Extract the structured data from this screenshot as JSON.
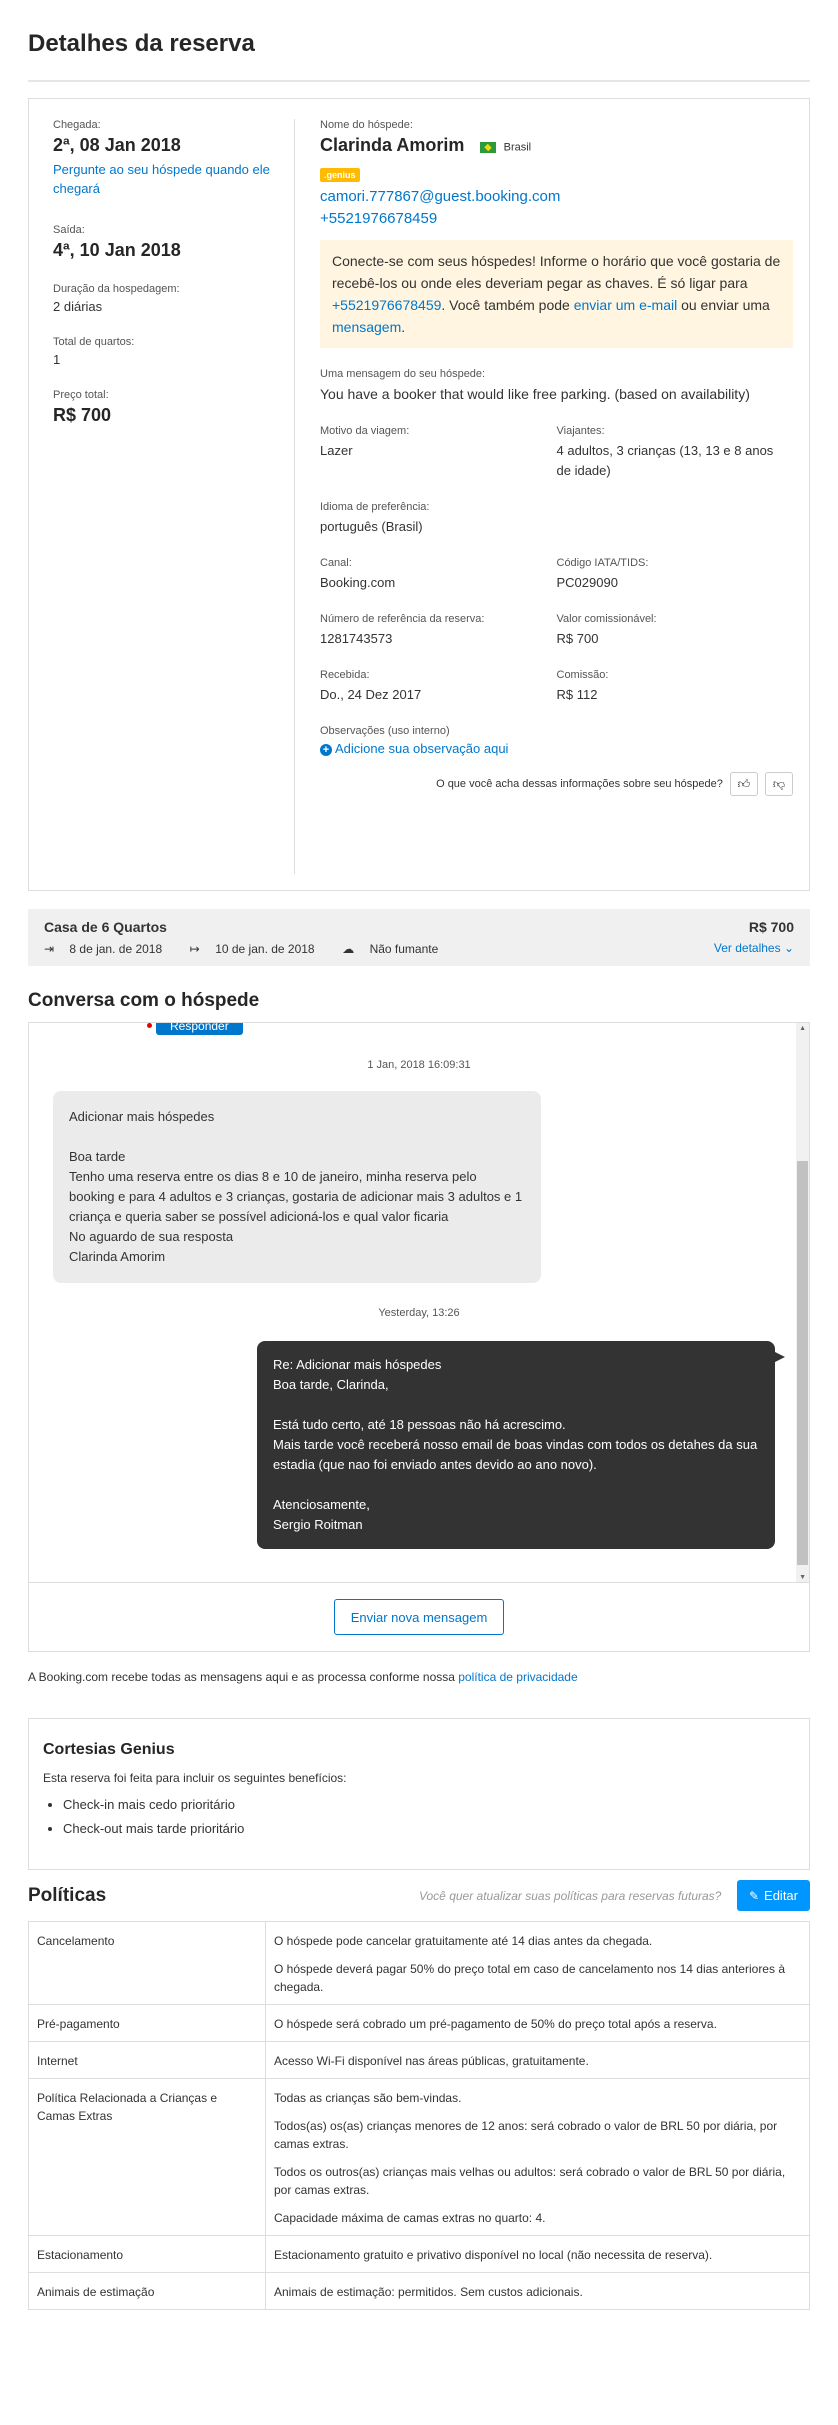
{
  "page": {
    "title": "Detalhes da reserva"
  },
  "booking": {
    "checkin_label": "Chegada:",
    "checkin_date": "2ª, 08 Jan 2018",
    "ask_guest_link": "Pergunte ao seu hóspede quando ele chegará",
    "checkout_label": "Saída:",
    "checkout_date": "4ª, 10 Jan 2018",
    "duration_label": "Duração da hospedagem:",
    "duration_value": "2 diárias",
    "rooms_label": "Total de quartos:",
    "rooms_value": "1",
    "price_label": "Preço total:",
    "price_value": "R$ 700"
  },
  "guest": {
    "name_label": "Nome do hóspede:",
    "name": "Clarinda Amorim",
    "country": "Brasil",
    "badge": ".genius",
    "email": "camori.777867@guest.booking.com",
    "phone": "+5521976678459",
    "notice": {
      "part1": "Conecte-se com seus hóspedes! Informe o horário que você gostaria de recebê-los ou onde eles deveriam pegar as chaves. É só ligar para ",
      "phone": "+5521976678459",
      "part2": ". Você também pode ",
      "email_link": "enviar um e-mail",
      "part3": " ou enviar uma ",
      "msg_link": "mensagem",
      "part4": "."
    },
    "message_label": "Uma mensagem do seu hóspede:",
    "message": "You have a booker that would like free parking. (based on availability)",
    "details": [
      {
        "label": "Motivo da viagem:",
        "value": "Lazer"
      },
      {
        "label": "Viajantes:",
        "value": "4 adultos, 3 crianças (13, 13 e 8 anos de idade)"
      },
      {
        "label": "Idioma de preferência:",
        "value": "português (Brasil)"
      },
      {
        "label": "",
        "value": ""
      },
      {
        "label": "Canal:",
        "value": "Booking.com"
      },
      {
        "label": "Código IATA/TIDS:",
        "value": "PC029090"
      },
      {
        "label": "Número de referência da reserva:",
        "value": "1281743573"
      },
      {
        "label": "Valor comissionável:",
        "value": "R$ 700"
      },
      {
        "label": "Recebida:",
        "value": "Do., 24 Dez 2017"
      },
      {
        "label": "Comissão:",
        "value": "R$ 112"
      }
    ],
    "notes_label": "Observações (uso interno)",
    "notes_add": "Adicione sua observação aqui",
    "feedback_q": "O que você acha dessas informações sobre seu hóspede?"
  },
  "room": {
    "title": "Casa de 6 Quartos",
    "checkin": "8 de jan. de 2018",
    "checkout": "10 de jan. de 2018",
    "smoking": "Não fumante",
    "price": "R$ 700",
    "more": "Ver detalhes"
  },
  "conversation": {
    "title": "Conversa com o hóspede",
    "reply": "Responder",
    "stamp1": "1 Jan, 2018 16:09:31",
    "incoming": [
      "Adicionar mais hóspedes",
      "",
      "Boa tarde",
      "Tenho uma reserva entre os dias 8 e 10 de janeiro, minha reserva pelo booking e para 4 adultos e 3 crianças, gostaria de adicionar mais 3 adultos e 1 criança e queria saber se possível adicioná-los e qual valor ficaria",
      "No aguardo de sua resposta",
      "Clarinda Amorim"
    ],
    "stamp2": "Yesterday, 13:26",
    "outgoing": [
      "Re: Adicionar mais hóspedes",
      "Boa tarde, Clarinda,",
      "",
      "Está tudo certo, até 18 pessoas não há acrescimo.",
      "Mais tarde você receberá nosso email de boas vindas com todos os detahes da sua estadia (que nao foi enviado antes devido ao ano novo).",
      "",
      "Atenciosamente,",
      "Sergio Roitman"
    ],
    "send_button": "Enviar nova mensagem",
    "privacy_text": "A Booking.com recebe todas as mensagens aqui e as processa conforme nossa ",
    "privacy_link": "política de privacidade"
  },
  "genius": {
    "title": "Cortesias Genius",
    "intro": "Esta reserva foi feita para incluir os seguintes benefícios:",
    "items": [
      "Check-in mais cedo prioritário",
      "Check-out mais tarde prioritário"
    ]
  },
  "policies": {
    "title": "Políticas",
    "question": "Você quer atualizar suas políticas para reservas futuras?",
    "edit": "Editar",
    "rows": [
      {
        "key": "Cancelamento",
        "values": [
          "O hóspede pode cancelar gratuitamente até 14 dias antes da chegada.",
          "O hóspede deverá pagar 50% do preço total em caso de cancelamento nos 14 dias anteriores à chegada."
        ]
      },
      {
        "key": "Pré-pagamento",
        "values": [
          "O hóspede será cobrado um pré-pagamento de 50% do preço total após a reserva."
        ]
      },
      {
        "key": "Internet",
        "values": [
          "Acesso Wi-Fi disponível nas áreas públicas, gratuitamente."
        ]
      },
      {
        "key": "Política Relacionada a Crianças e Camas Extras",
        "values": [
          "Todas as crianças são bem-vindas.",
          "Todos(as) os(as) crianças menores de 12 anos: será cobrado o valor de BRL 50 por diária, por camas extras.",
          "Todos os outros(as) crianças mais velhas ou adultos: será cobrado o valor de BRL 50 por diária, por camas extras.",
          "Capacidade máxima de camas extras no quarto: 4."
        ]
      },
      {
        "key": "Estacionamento",
        "values": [
          "Estacionamento gratuito e privativo disponível no local (não necessita de reserva)."
        ]
      },
      {
        "key": "Animais de estimação",
        "values": [
          "Animais de estimação: permitidos. Sem custos adicionais."
        ]
      }
    ]
  }
}
